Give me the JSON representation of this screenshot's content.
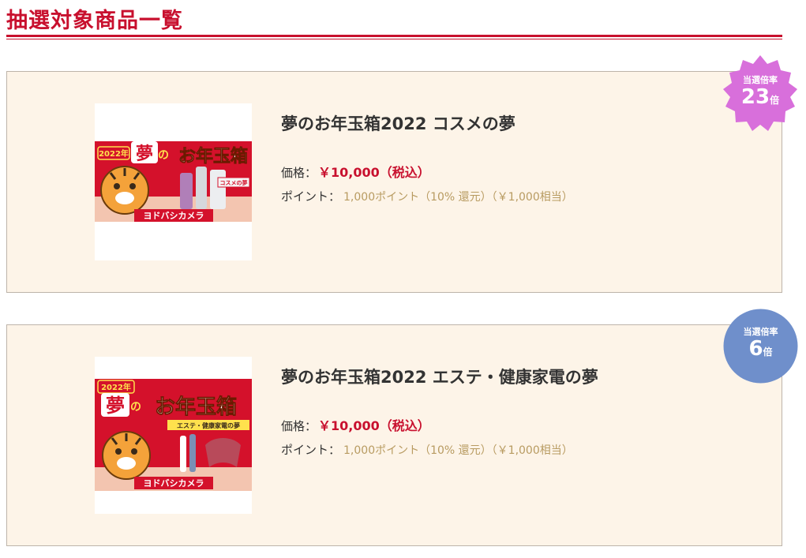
{
  "page": {
    "heading": "抽選対象商品一覧"
  },
  "colors": {
    "accent": "#c8102e",
    "card_bg": "#fdf4e8",
    "points_text": "#b89b61",
    "badge1": "#d86fdb",
    "badge2": "#6f8fcb"
  },
  "products": [
    {
      "title": "夢のお年玉箱2022 コスメの夢",
      "price_label": "価格：",
      "price_value": "￥10,000（税込）",
      "points_label": "ポイント：",
      "points_value": "1,000ポイント（10% 還元）（￥1,000相当）",
      "badge": {
        "label": "当選倍率",
        "number": "23",
        "unit": "倍"
      },
      "image": {
        "year": "2022年",
        "yume": "夢",
        "no": "の",
        "otoshidama": "お年玉箱",
        "sub": "コスメの夢",
        "brand": "ヨドバシカメラ"
      }
    },
    {
      "title": "夢のお年玉箱2022 エステ・健康家電の夢",
      "price_label": "価格：",
      "price_value": "￥10,000（税込）",
      "points_label": "ポイント：",
      "points_value": "1,000ポイント（10% 還元）（￥1,000相当）",
      "badge": {
        "label": "当選倍率",
        "number": "6",
        "unit": "倍"
      },
      "image": {
        "year": "2022年",
        "yume": "夢",
        "no": "の",
        "otoshidama": "お年玉箱",
        "sub": "エステ・健康家電の夢",
        "brand": "ヨドバシカメラ"
      }
    }
  ]
}
